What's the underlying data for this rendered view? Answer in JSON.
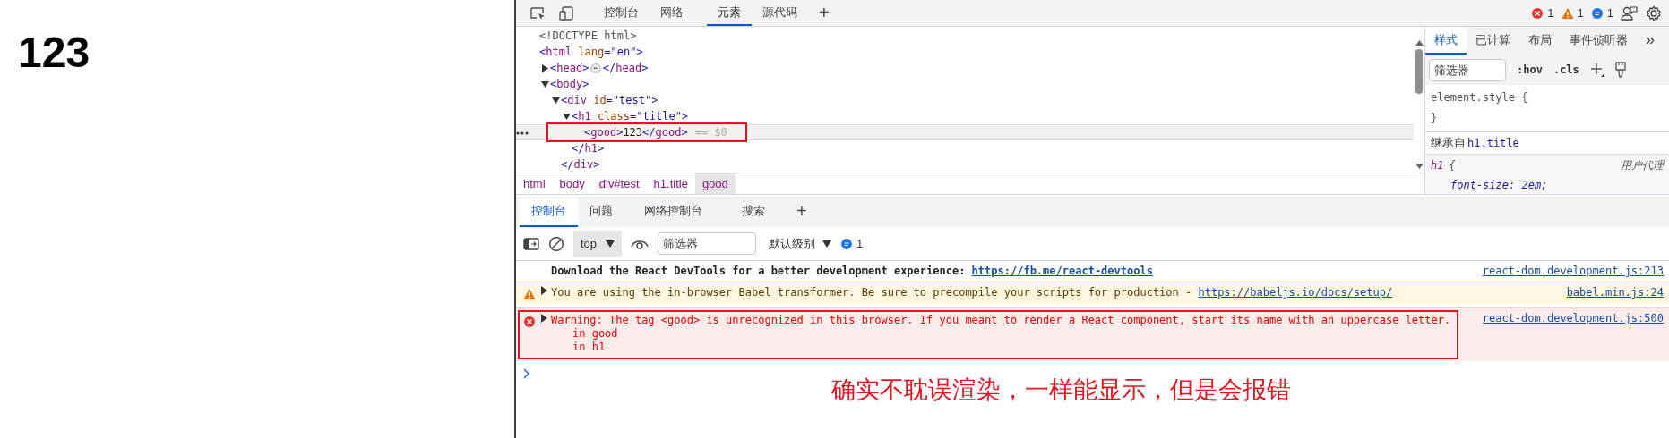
{
  "page": {
    "heading": "123"
  },
  "devtools": {
    "main_tabs": [
      {
        "label": "控制台",
        "selected": false
      },
      {
        "label": "网络",
        "selected": false
      },
      {
        "label": "元素",
        "selected": true
      },
      {
        "label": "源代码",
        "selected": false
      }
    ],
    "add_tab": "+",
    "counts": [
      {
        "kind": "error",
        "count": "1"
      },
      {
        "kind": "warning",
        "count": "1"
      },
      {
        "kind": "info",
        "count": "1"
      }
    ],
    "elements": {
      "nodes": [
        {
          "kind": "doctype",
          "text": "<!DOCTYPE html>"
        },
        {
          "kind": "element",
          "text": "<html lang=\"en\">",
          "selected": false,
          "children": [
            {
              "kind": "element",
              "text": "<head>",
              "selected": false,
              "expanded": false,
              "ellipsis": "⋯",
              "close": "</head>"
            },
            {
              "kind": "element",
              "text": "<body>",
              "selected": false,
              "expanded": true,
              "children": [
                {
                  "kind": "element",
                  "text": "<div id=\"test\">",
                  "selected": false,
                  "expanded": true,
                  "children": [
                    {
                      "kind": "element",
                      "text": "<h1 class=\"title\">",
                      "selected": false,
                      "expanded": true,
                      "children": [
                        {
                          "kind": "element",
                          "text": "<good>123</good>",
                          "selected": true,
                          "framed": true,
                          "marker": "== $0"
                        }
                      ]
                    },
                    {
                      "kind": "close",
                      "text": "</h1>"
                    }
                  ]
                },
                {
                  "kind": "close",
                  "text": "</div>"
                }
              ]
            }
          ]
        }
      ],
      "breadcrumbs": [
        {
          "label": "html",
          "selected": false
        },
        {
          "label": "body",
          "selected": false
        },
        {
          "label": "div#test",
          "selected": false
        },
        {
          "label": "h1.title",
          "selected": false
        },
        {
          "label": "good",
          "selected": true
        }
      ]
    },
    "styles": {
      "tabs": [
        {
          "label": "样式",
          "selected": true
        },
        {
          "label": "已计算",
          "selected": false
        },
        {
          "label": "布局",
          "selected": false
        },
        {
          "label": "事件侦听器",
          "selected": false
        }
      ],
      "more": "»",
      "filter": {
        "placeholder": "筛选器"
      },
      "toggles": [
        ":hov",
        ".cls"
      ],
      "element_style": {
        "open": "element.style {",
        "close": "}"
      },
      "inherited": {
        "label": "继承自",
        "selector": "h1.title"
      },
      "rule": {
        "selector": "h1",
        "brace": "{",
        "origin": "用户代理",
        "declarations": [
          "font-size: 2em;"
        ]
      }
    },
    "console": {
      "tabs": [
        {
          "label": "控制台",
          "selected": true
        },
        {
          "label": "问题",
          "selected": false
        },
        {
          "label": "网络控制台",
          "selected": false
        },
        {
          "label": "搜索",
          "selected": false
        }
      ],
      "add_tab": "+",
      "context": "top",
      "filter": {
        "placeholder": "筛选器"
      },
      "levels": "默认级别",
      "message_count": "1",
      "messages": [
        {
          "kind": "info",
          "text": "Download the React DevTools for a better development experience: ",
          "link": "https://fb.me/react-devtools",
          "source": "react-dom.development.js:213",
          "expandable": false,
          "framed": false
        },
        {
          "kind": "warning",
          "text": "You are using the in-browser Babel transformer. Be sure to precompile your scripts for production - ",
          "link": "https://babeljs.io/docs/setup/",
          "source": "babel.min.js:24",
          "expandable": true,
          "framed": false
        },
        {
          "kind": "error",
          "text": "Warning: The tag <good> is unrecognized in this browser. If you meant to render a React component, start its name with an uppercase letter.",
          "stack": [
            "in good",
            "in h1"
          ],
          "source": "react-dom.development.js:500",
          "expandable": true,
          "framed": true
        }
      ]
    }
  },
  "annotation": "确实不耽误渲染，一样能显示，但是会报错"
}
